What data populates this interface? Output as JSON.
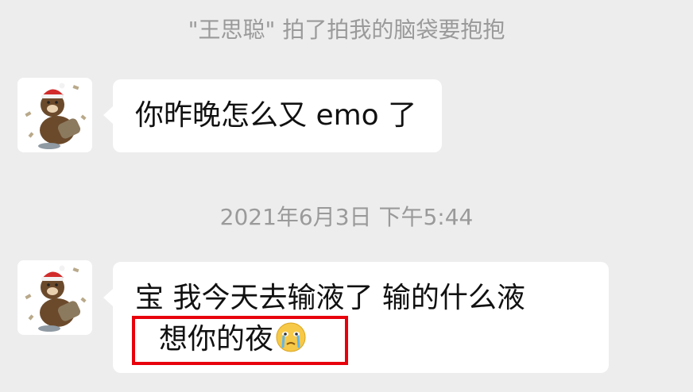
{
  "chat": {
    "pat_notice": "\"王思聪\" 拍了拍我的脑袋要抱抱",
    "timestamp": "2021年6月3日 下午5:44",
    "messages": [
      {
        "sender_avatar": "brown-bear-santa-hat-avatar",
        "text": "你昨晚怎么又 emo 了"
      },
      {
        "sender_avatar": "brown-bear-santa-hat-avatar",
        "line1": "宝  我今天去输液了   输的什么液",
        "line2": "想你的夜",
        "trailing_emoji": "crying-face-emoji"
      }
    ]
  },
  "colors": {
    "background": "#ededed",
    "bubble": "#ffffff",
    "system_text": "#9a9a9a",
    "highlight_border": "#e8000b"
  }
}
